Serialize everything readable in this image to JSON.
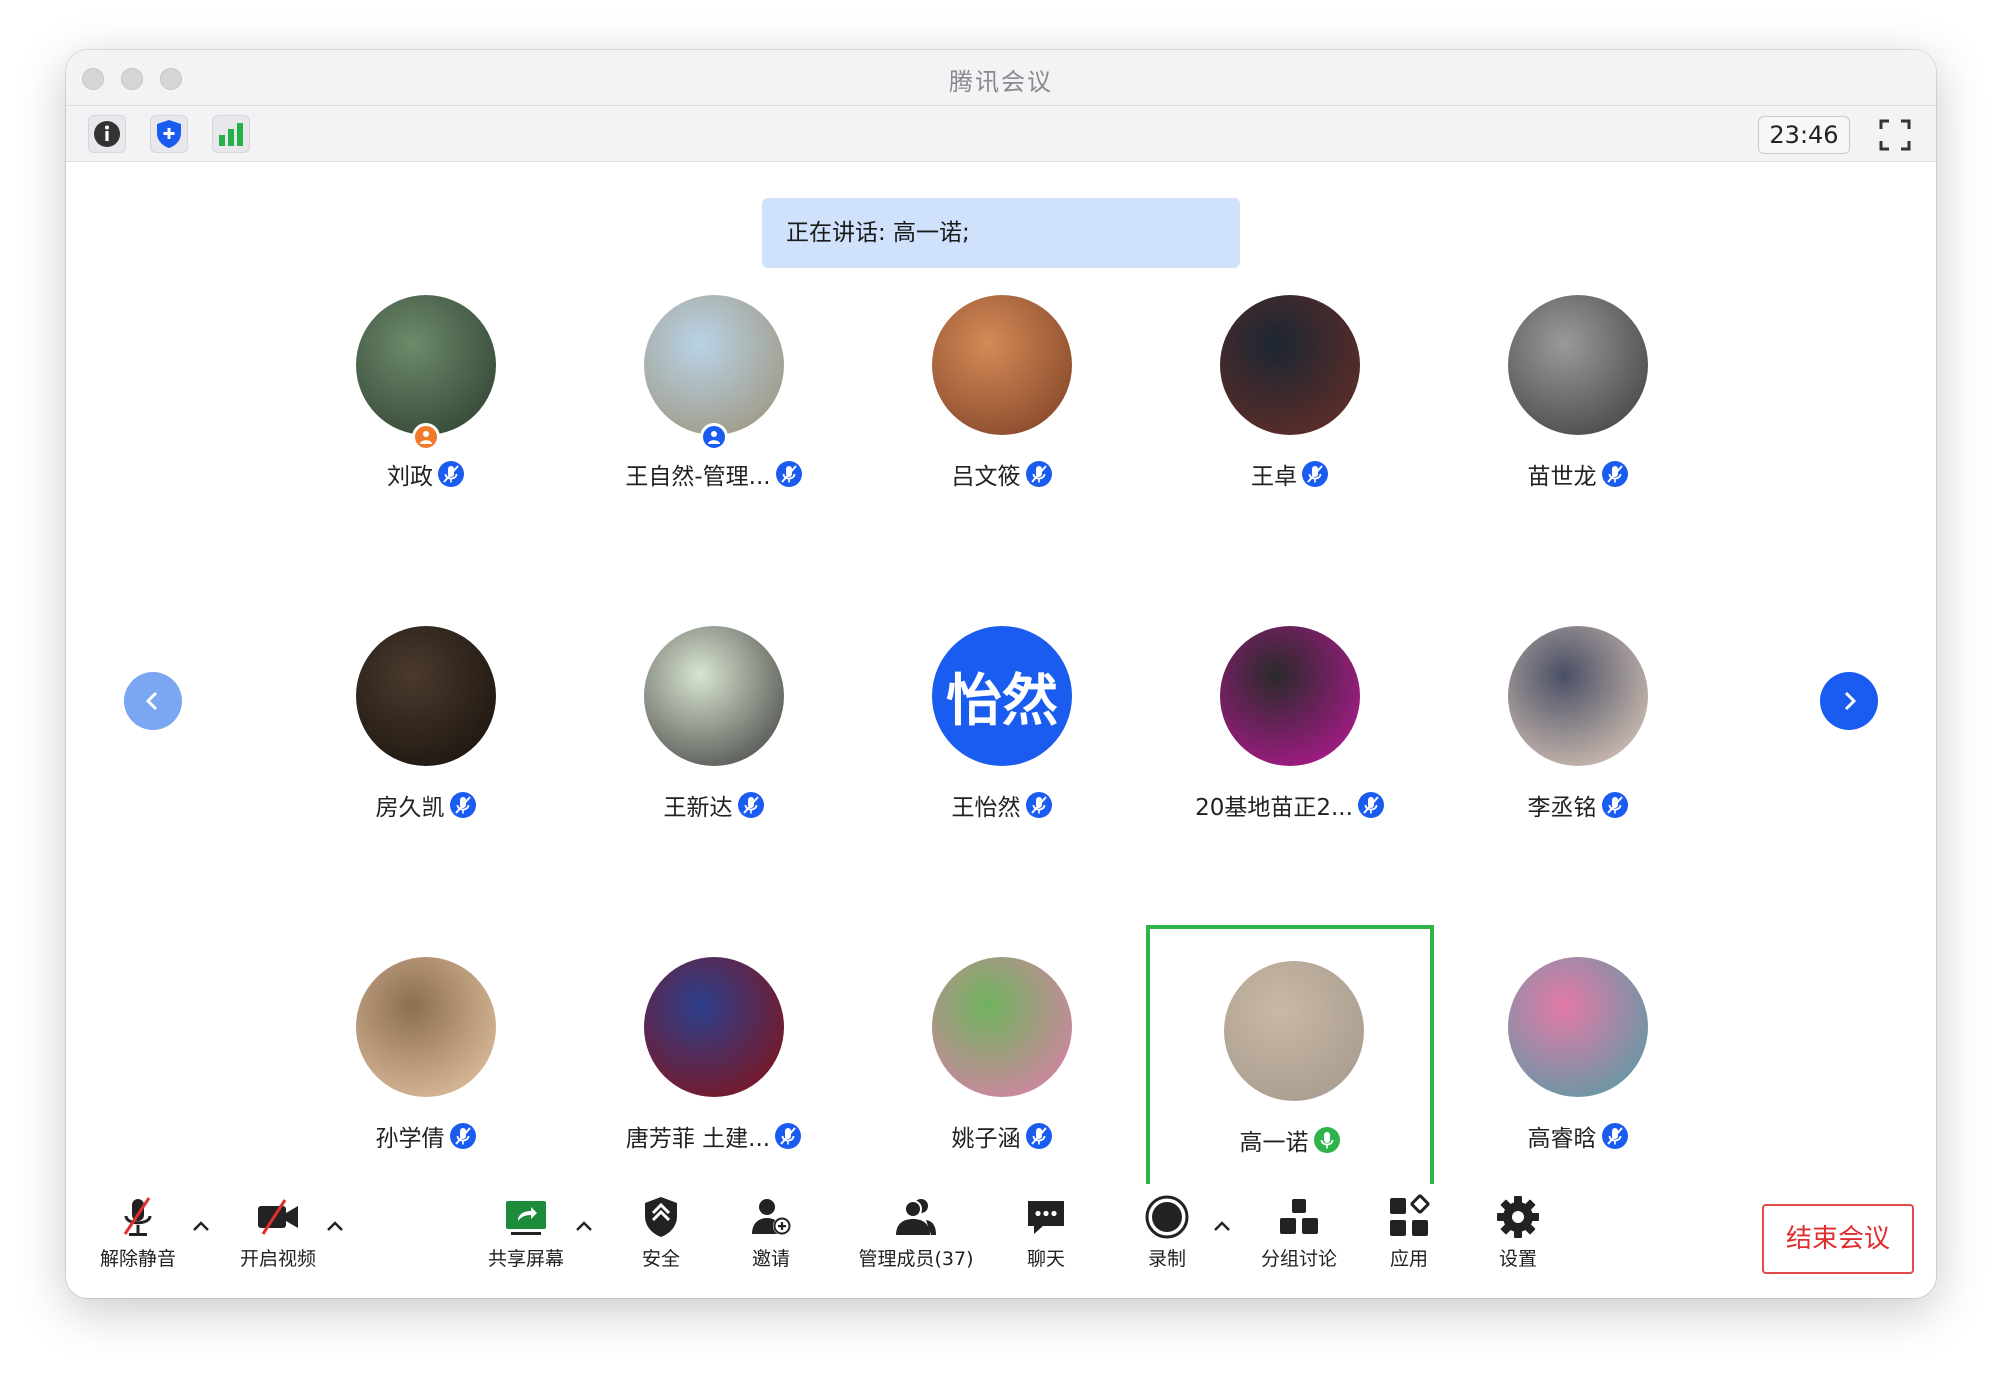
{
  "window": {
    "title": "腾讯会议"
  },
  "toolbar": {
    "time": "23:46"
  },
  "banner": {
    "text": "正在讲话: 高一诺;"
  },
  "participants": [
    {
      "name": "刘政",
      "role": "host"
    },
    {
      "name": "王自然-管理...",
      "role": "cohost"
    },
    {
      "name": "吕文筱",
      "role": ""
    },
    {
      "name": "王卓",
      "role": ""
    },
    {
      "name": "苗世龙",
      "role": ""
    },
    {
      "name": "房久凯",
      "role": ""
    },
    {
      "name": "王新达",
      "role": ""
    },
    {
      "name": "王怡然",
      "role": "",
      "avatar_text": "怡然"
    },
    {
      "name": "20基地苗正2...",
      "role": ""
    },
    {
      "name": "李丞铭",
      "role": ""
    },
    {
      "name": "孙学倩",
      "role": ""
    },
    {
      "name": "唐芳菲 土建...",
      "role": ""
    },
    {
      "name": "姚子涵",
      "role": ""
    },
    {
      "name": "高一诺",
      "role": "",
      "speaking": true
    },
    {
      "name": "高睿晗",
      "role": ""
    }
  ],
  "bottombar": {
    "unmute": "解除静音",
    "start_video": "开启视频",
    "share_screen": "共享屏幕",
    "security": "安全",
    "invite": "邀请",
    "manage_members": "管理成员(37)",
    "chat": "聊天",
    "record": "录制",
    "breakout": "分组讨论",
    "apps": "应用",
    "settings": "设置",
    "end_meeting": "结束会议"
  },
  "colors": {
    "accent": "#1a5cf0",
    "speaking_border": "#2fb34a",
    "end_red": "#e02e2e",
    "banner_bg": "#cfe1fb"
  }
}
